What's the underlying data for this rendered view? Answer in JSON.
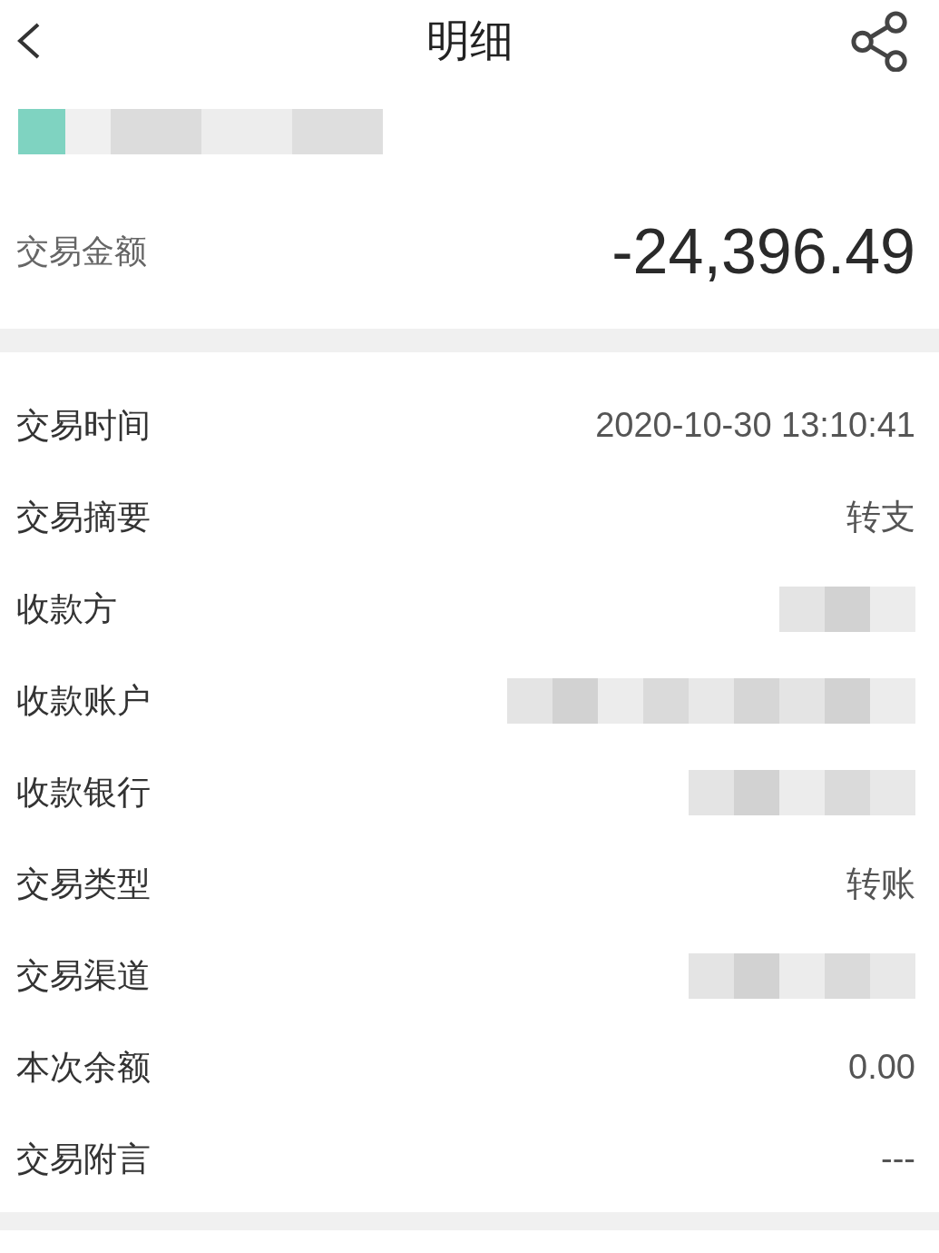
{
  "header": {
    "title": "明细"
  },
  "account": {
    "kind": "redacted"
  },
  "amount": {
    "label": "交易金额",
    "value": "-24,396.49"
  },
  "rows": [
    {
      "label": "交易时间",
      "kind": "text",
      "value": "2020-10-30 13:10:41"
    },
    {
      "label": "交易摘要",
      "kind": "text",
      "value": "转支"
    },
    {
      "label": "收款方",
      "kind": "blurshort"
    },
    {
      "label": "收款账户",
      "kind": "blurlong"
    },
    {
      "label": "收款银行",
      "kind": "blurmedium"
    },
    {
      "label": "交易类型",
      "kind": "text",
      "value": "转账"
    },
    {
      "label": "交易渠道",
      "kind": "blurmedium"
    },
    {
      "label": "本次余额",
      "kind": "text",
      "value": "0.00"
    },
    {
      "label": "交易附言",
      "kind": "text",
      "value": "---"
    }
  ]
}
